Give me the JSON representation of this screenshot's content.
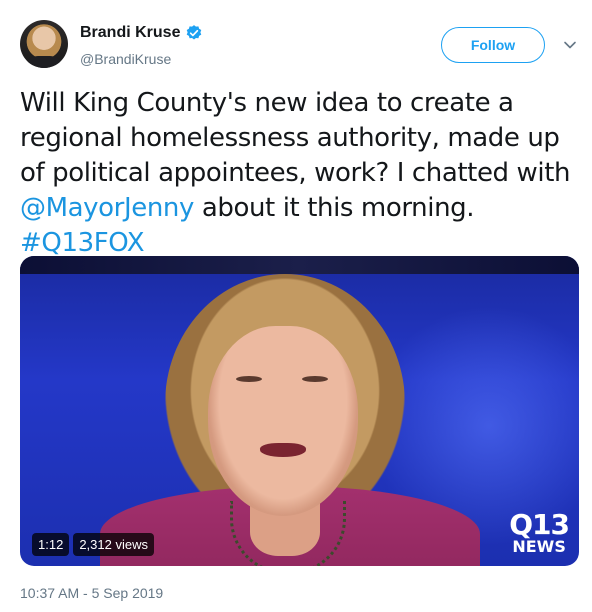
{
  "author": {
    "name": "Brandi Kruse",
    "handle": "@BrandiKruse",
    "verified": true
  },
  "follow_label": "Follow",
  "tweet": {
    "text_part1": "Will King County's new idea to create a regional homelessness authority, made up of political appointees, work? I chatted with ",
    "mention": "@MayorJenny",
    "text_part2": " about it this morning. ",
    "hashtag": "#Q13FOX"
  },
  "media": {
    "duration": "1:12",
    "views": "2,312 views",
    "logo_top": "Q13",
    "logo_bottom": "NEWS"
  },
  "timestamp": "10:37 AM - 5 Sep 2019",
  "colors": {
    "accent": "#1da1f2",
    "link": "#1b95e0",
    "muted": "#657786"
  },
  "icons": [
    "verified-icon",
    "chevron-down-icon"
  ]
}
